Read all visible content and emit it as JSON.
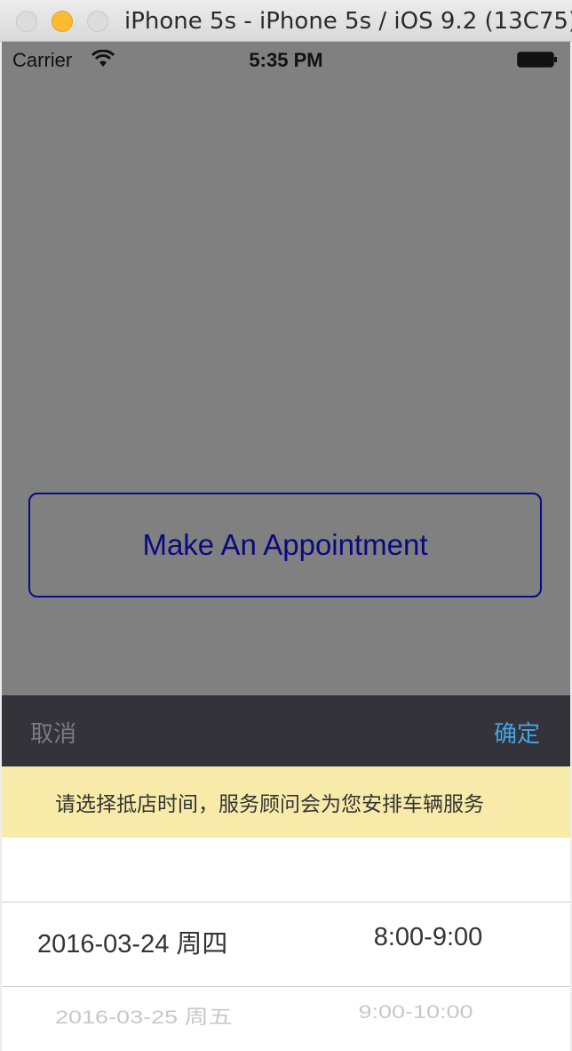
{
  "window": {
    "title": "iPhone 5s - iPhone 5s / iOS 9.2 (13C75)"
  },
  "status_bar": {
    "carrier": "Carrier",
    "time": "5:35 PM"
  },
  "main": {
    "appointment_button_label": "Make An Appointment"
  },
  "picker_toolbar": {
    "cancel_label": "取消",
    "confirm_label": "确定"
  },
  "notice": {
    "text": "请选择抵店时间，服务顾问会为您安排车辆服务"
  },
  "picker": {
    "rows": [
      {
        "date": "2016-03-24 周四",
        "slot": "8:00-9:00",
        "selected": true
      },
      {
        "date": "2016-03-25 周五",
        "slot": "9:00-10:00",
        "selected": false
      }
    ]
  },
  "colors": {
    "screen_background": "#808080",
    "button_border": "#0a0a8a",
    "toolbar_background": "#343339",
    "confirm_text": "#44a3e6",
    "notice_background": "#f8eba9"
  }
}
